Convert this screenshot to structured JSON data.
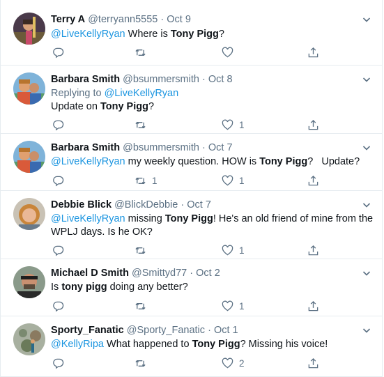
{
  "tweets": [
    {
      "name": "Terry A",
      "handle": "@terryann5555",
      "separator": "·",
      "date": "Oct 9",
      "replying_label": "",
      "replying_to": "",
      "mention": "@LiveKellyRyan",
      "text_a": " Where is ",
      "bold_a": "Tony Pigg",
      "text_b": "?",
      "retweets": "",
      "likes": ""
    },
    {
      "name": "Barbara Smith",
      "handle": "@bsummersmith",
      "separator": "·",
      "date": "Oct 8",
      "replying_label": "Replying to ",
      "replying_to": "@LiveKellyRyan",
      "mention": "",
      "text_a": "Update on ",
      "bold_a": "Tony Pigg",
      "text_b": "?",
      "retweets": "",
      "likes": "1"
    },
    {
      "name": "Barbara Smith",
      "handle": "@bsummersmith",
      "separator": "·",
      "date": "Oct 7",
      "replying_label": "",
      "replying_to": "",
      "mention": "@LiveKellyRyan",
      "text_a": " my weekly question. HOW is ",
      "bold_a": "Tony Pigg",
      "text_b": "?   Update?",
      "retweets": "1",
      "likes": "1"
    },
    {
      "name": "Debbie Blick",
      "handle": "@BlickDebbie",
      "separator": "·",
      "date": "Oct 7",
      "replying_label": "",
      "replying_to": "",
      "mention": "@LiveKellyRyan",
      "text_a": " missing ",
      "bold_a": "Tony Pigg",
      "text_b": "! He's an old friend of mine from the WPLJ days. Is he OK?",
      "retweets": "",
      "likes": "1"
    },
    {
      "name": "Michael D Smith",
      "handle": "@Smittyd77",
      "separator": "·",
      "date": "Oct 2",
      "replying_label": "",
      "replying_to": "",
      "mention": "",
      "text_a": "Is ",
      "bold_a": "tony pigg",
      "text_b": " doing any better?",
      "retweets": "",
      "likes": "1"
    },
    {
      "name": "Sporty_Fanatic",
      "handle": "@Sporty_Fanatic",
      "separator": "·",
      "date": "Oct 1",
      "replying_label": "",
      "replying_to": "",
      "mention": "@KellyRipa",
      "text_a": " What happened to ",
      "bold_a": "Tony Pigg",
      "text_b": "? Missing his voice!",
      "retweets": "",
      "likes": "2"
    }
  ],
  "icons": {
    "reply": "reply-icon",
    "retweet": "retweet-icon",
    "like": "like-icon",
    "share": "share-icon",
    "more": "chevron-down-icon"
  },
  "colors": {
    "link": "#1b95e0",
    "secondary": "#5b7083",
    "text": "#0f1419",
    "divider": "#e6ecf0"
  }
}
